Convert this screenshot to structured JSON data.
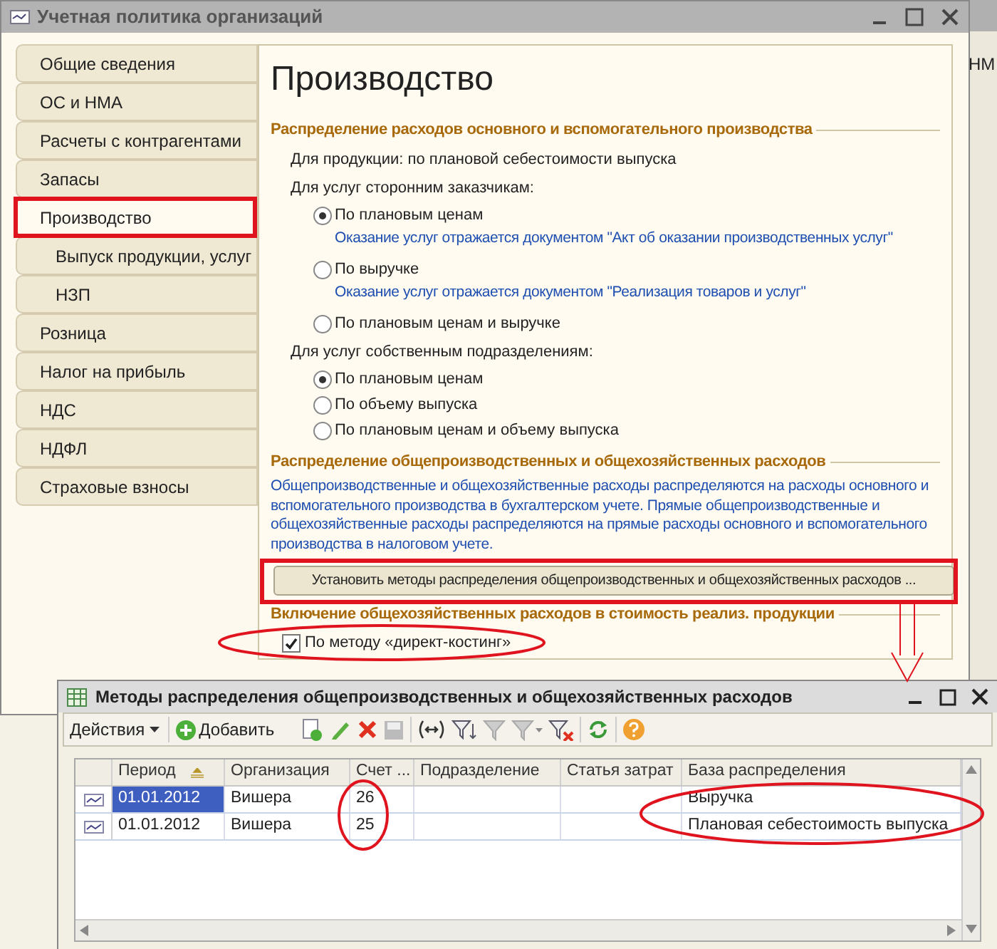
{
  "background_window": {
    "tab_text": "НМ"
  },
  "main_window": {
    "title": "Учетная политика организаций",
    "sidebar": {
      "items": [
        {
          "label": "Общие сведения",
          "selected": false
        },
        {
          "label": "ОС и НМА",
          "selected": false
        },
        {
          "label": "Расчеты с контрагентами",
          "selected": false
        },
        {
          "label": "Запасы",
          "selected": false
        },
        {
          "label": "Производство",
          "selected": true,
          "children": [
            {
              "label": "Выпуск продукции, услуг",
              "selected": false
            },
            {
              "label": "НЗП",
              "selected": false
            }
          ]
        },
        {
          "label": "Розница",
          "selected": false
        },
        {
          "label": "Налог на прибыль",
          "selected": false
        },
        {
          "label": "НДС",
          "selected": false
        },
        {
          "label": "НДФЛ",
          "selected": false
        },
        {
          "label": "Страховые взносы",
          "selected": false
        }
      ]
    },
    "content": {
      "heading": "Производство",
      "sections": [
        {
          "title": "Распределение расходов основного и вспомогательного производства",
          "blocks": [
            {
              "kind": "text",
              "text": "Для продукции: по плановой себестоимости выпуска"
            },
            {
              "kind": "radio_group",
              "label": "Для услуг сторонним заказчикам:",
              "options": [
                {
                  "label": "По плановым ценам",
                  "selected": true,
                  "note": "Оказание услуг отражается документом \"Акт об оказании производственных услуг\""
                },
                {
                  "label": "По выручке",
                  "selected": false,
                  "note": "Оказание услуг отражается документом \"Реализация товаров и услуг\""
                },
                {
                  "label": "По плановым ценам и выручке",
                  "selected": false
                }
              ]
            },
            {
              "kind": "radio_group",
              "label": "Для услуг собственным подразделениям:",
              "options": [
                {
                  "label": "По плановым ценам",
                  "selected": true
                },
                {
                  "label": "По объему выпуска",
                  "selected": false
                },
                {
                  "label": "По плановым ценам и объему выпуска",
                  "selected": false
                }
              ]
            }
          ]
        },
        {
          "title": "Распределение общепроизводственных и общехозяйственных расходов",
          "blocks": [
            {
              "kind": "note",
              "text": "Общепроизводственные и общехозяйственные расходы распределяются на расходы основного и вспомогательного производства в бухгалтерском учете. Прямые общепроизводственные и общехозяйственные расходы распределяются на прямые расходы основного и вспомогательного производства в налоговом учете."
            },
            {
              "kind": "button",
              "label": "Установить методы распределения общепроизводственных и общехозяйственных расходов ..."
            }
          ]
        },
        {
          "title": "Включение общехозяйственных расходов в стоимость реализ. продукции",
          "blocks": [
            {
              "kind": "checkbox",
              "label": "По методу «директ-костинг»",
              "checked": true
            }
          ]
        }
      ]
    }
  },
  "second_window": {
    "title": "Методы распределения общепроизводственных и общехозяйственных расходов",
    "toolbar": {
      "actions_label": "Действия",
      "add_label": "Добавить"
    },
    "table": {
      "columns": [
        "Период",
        "Организация",
        "Счет ...",
        "Подразделение",
        "Статья затрат",
        "База распределения"
      ],
      "rows": [
        {
          "selected": true,
          "cells": [
            "01.01.2012",
            "Вишера",
            "26",
            "",
            "",
            "Выручка"
          ]
        },
        {
          "selected": false,
          "cells": [
            "01.01.2012",
            "Вишера",
            "25",
            "",
            "",
            "Плановая себестоимость выпуска"
          ]
        }
      ]
    }
  }
}
